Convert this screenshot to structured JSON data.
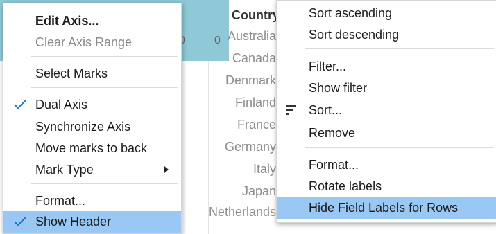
{
  "background": {
    "axis_fragments": [
      "0",
      "0"
    ],
    "country_header": "Country",
    "countries": [
      "Australia",
      "Canada",
      "Denmark",
      "Finland",
      "France",
      "Germany",
      "Italy",
      "Japan",
      "Netherlands"
    ]
  },
  "left_menu": {
    "items": [
      {
        "label": "Edit Axis...",
        "bold": true
      },
      {
        "label": "Clear Axis Range",
        "disabled": true
      },
      {
        "label": "Select Marks"
      },
      {
        "label": "Dual Axis",
        "checked": true
      },
      {
        "label": "Synchronize Axis"
      },
      {
        "label": "Move marks to back"
      },
      {
        "label": "Mark Type",
        "submenu": true
      },
      {
        "label": "Format..."
      },
      {
        "label": "Show Header",
        "checked": true,
        "highlighted": true
      }
    ]
  },
  "right_menu": {
    "items": [
      {
        "label": "Sort ascending"
      },
      {
        "label": "Sort descending"
      },
      {
        "label": "Filter..."
      },
      {
        "label": "Show filter"
      },
      {
        "label": "Sort...",
        "icon": "sort-icon"
      },
      {
        "label": "Remove"
      },
      {
        "label": "Format..."
      },
      {
        "label": "Rotate labels"
      },
      {
        "label": "Hide Field Labels for Rows",
        "highlighted": true
      }
    ]
  },
  "colors": {
    "highlight": "#99c8f5",
    "header_band": "#8fc9d8",
    "check": "#1e73c8"
  }
}
